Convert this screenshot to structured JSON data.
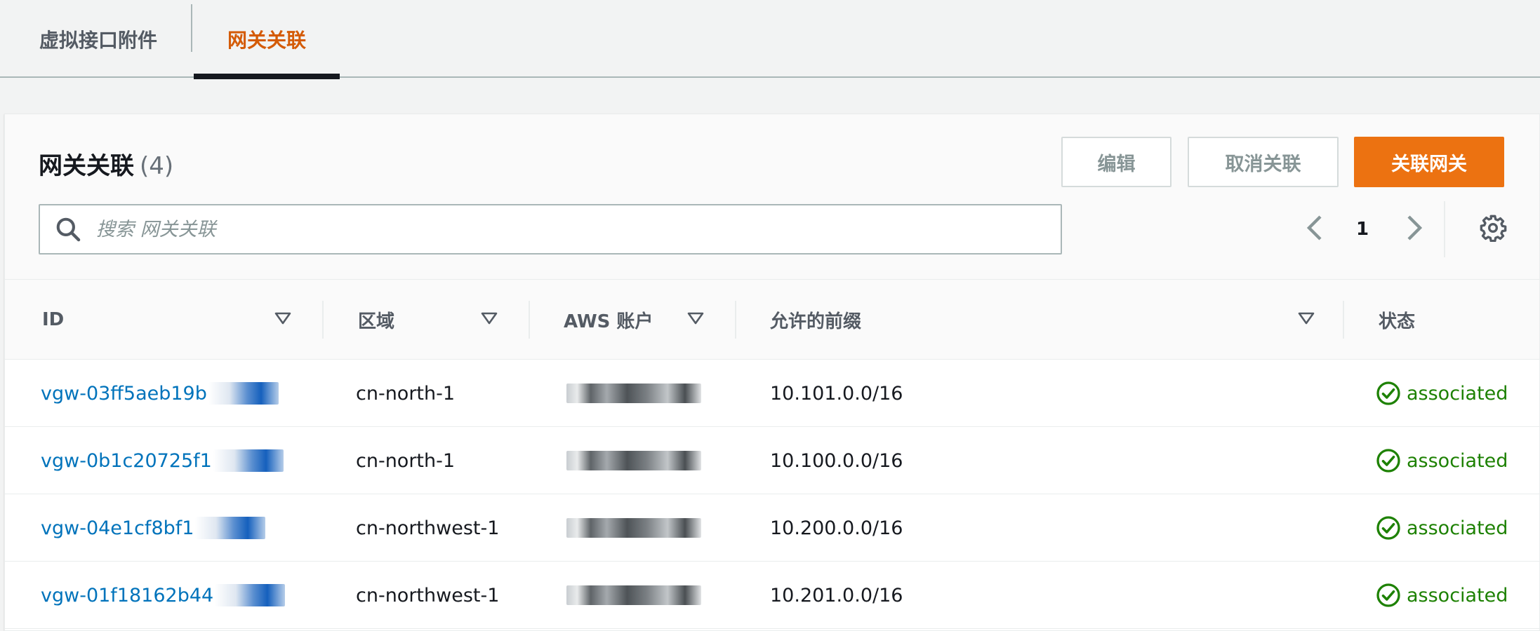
{
  "tabs": [
    {
      "label": "虚拟接口附件",
      "active": false
    },
    {
      "label": "网关关联",
      "active": true
    }
  ],
  "panel": {
    "title": "网关关联",
    "count": "(4)",
    "buttons": {
      "edit": "编辑",
      "disassociate": "取消关联",
      "associate": "关联网关"
    },
    "search": {
      "placeholder": "搜索 网关关联",
      "value": ""
    },
    "pagination": {
      "current_page": "1"
    }
  },
  "table": {
    "columns": [
      "ID",
      "区域",
      "AWS 账户",
      "允许的前缀",
      "状态"
    ],
    "rows": [
      {
        "id": "vgw-03ff5aeb19b",
        "region": "cn-north-1",
        "account": "",
        "prefix": "10.101.0.0/16",
        "status": "associated"
      },
      {
        "id": "vgw-0b1c20725f1",
        "region": "cn-north-1",
        "account": "",
        "prefix": "10.100.0.0/16",
        "status": "associated"
      },
      {
        "id": "vgw-04e1cf8bf1",
        "region": "cn-northwest-1",
        "account": "",
        "prefix": "10.200.0.0/16",
        "status": "associated"
      },
      {
        "id": "vgw-01f18162b44",
        "region": "cn-northwest-1",
        "account": "",
        "prefix": "10.201.0.0/16",
        "status": "associated"
      }
    ]
  },
  "icons": {
    "search": "search-icon",
    "prev": "chevron-left-icon",
    "next": "chevron-right-icon",
    "settings": "gear-icon",
    "sort": "caret-down-icon",
    "status": "check-circle-icon"
  },
  "colors": {
    "accent": "#ec7211",
    "active_tab": "#d45b07",
    "link": "#0073bb",
    "success": "#1d8102"
  }
}
